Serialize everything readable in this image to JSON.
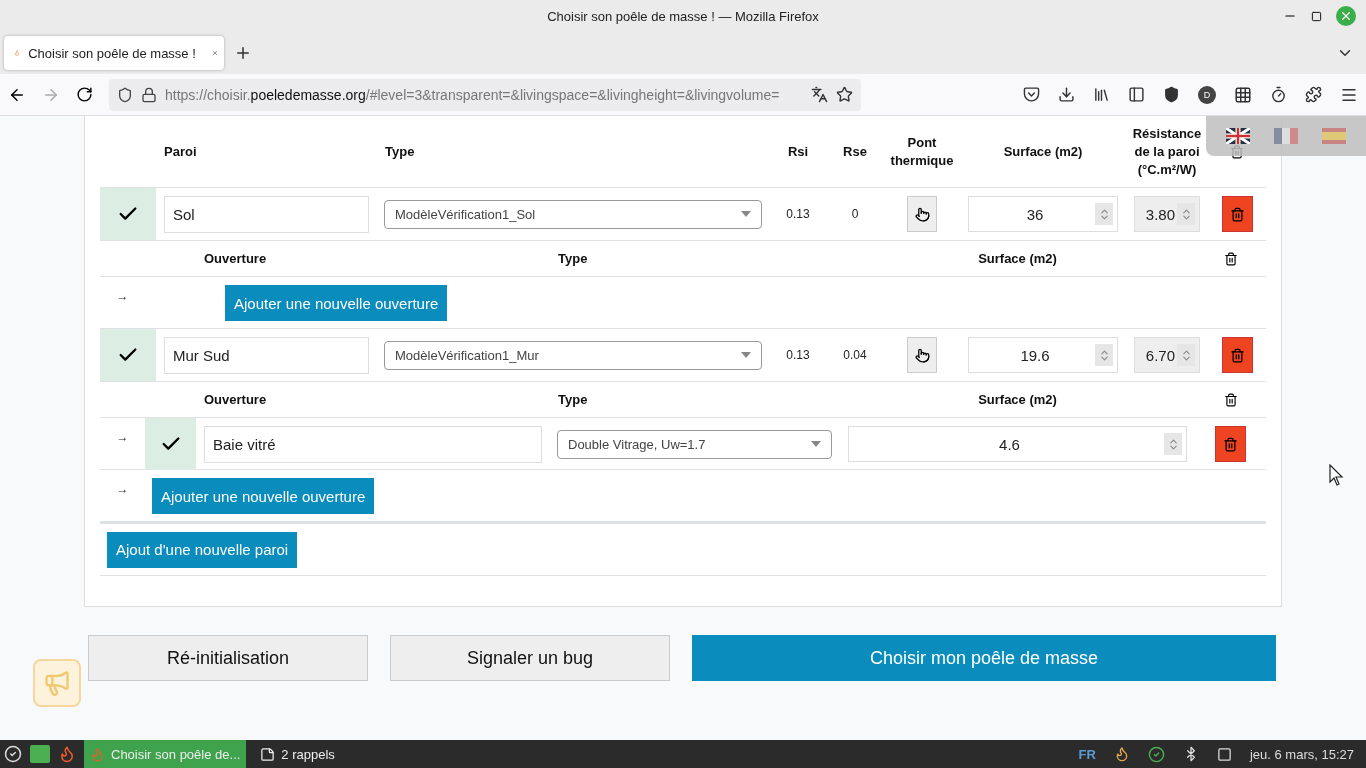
{
  "window": {
    "title": "Choisir son poêle de masse ! — Mozilla Firefox"
  },
  "tabs": [
    {
      "label": "Choisir son poêle de masse !",
      "selected": true
    }
  ],
  "address_bar": {
    "url_prefix": "https://choisir.",
    "url_domain": "poeledemasse.org",
    "url_rest": "/#level=3&transparent=&livingspace=&livingheight=&livingvolume="
  },
  "toolbar": {
    "account_initial": "D"
  },
  "language_menu": [
    {
      "kind": "uk",
      "selected": true
    },
    {
      "kind": "fr",
      "selected": false
    },
    {
      "kind": "es",
      "selected": false
    }
  ],
  "walls_table": {
    "columns": [
      "Paroi",
      "Type",
      "Rsi",
      "Rse",
      "Pont thermique",
      "Surface (m2)",
      "Résistance de la paroi (°C.m²/W)"
    ],
    "walls": [
      {
        "checked": true,
        "name": "Sol",
        "type": "ModèleVérification1_Sol",
        "rsi": "0.13",
        "rse": "0",
        "surface": "36",
        "resistance": "3.80",
        "opening_columns": [
          "Ouverture",
          "Type",
          "Surface (m2)"
        ],
        "add_arrow": "→",
        "add_opening": "Ajouter une nouvelle ouverture"
      },
      {
        "checked": true,
        "name": "Mur Sud",
        "type": "ModèleVérification1_Mur",
        "rsi": "0.13",
        "rse": "0.04",
        "surface": "19.6",
        "resistance": "6.70",
        "opening_columns": [
          "Ouverture",
          "Type",
          "Surface (m2)"
        ],
        "openings": [
          {
            "arrow": "→",
            "checked": true,
            "name": "Baie vitré",
            "type": "Double Vitrage, Uw=1.7",
            "surface": "4.6"
          }
        ],
        "add_arrow": "→",
        "add_opening": "Ajouter une nouvelle ouverture"
      }
    ],
    "add_wall": "Ajout d'une nouvelle paroi"
  },
  "actions": [
    {
      "label": "Ré-initialisation",
      "kind": "secondary"
    },
    {
      "label": "Signaler un bug",
      "kind": "secondary"
    },
    {
      "label": "Choisir mon poêle de masse",
      "kind": "primary"
    }
  ],
  "taskbar": {
    "windows": [
      {
        "label": "Choisir son poêle de...",
        "selected": true,
        "kind": "browser"
      },
      {
        "label": "2 rappels",
        "selected": false,
        "kind": "notes"
      }
    ],
    "language": "FR",
    "clock": "jeu. 6 mars, 15:27"
  }
}
